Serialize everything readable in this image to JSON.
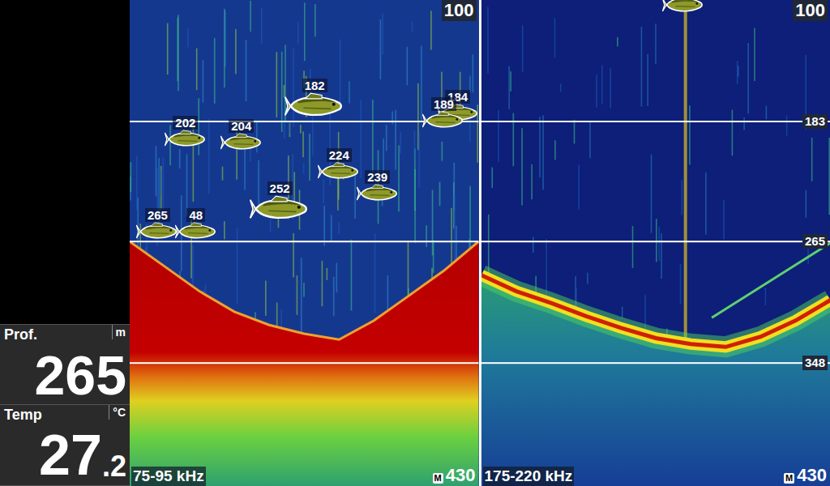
{
  "sidebar": {
    "depth_readout": {
      "label": "Prof.",
      "unit": "m",
      "value": "265"
    },
    "temp_readout": {
      "label": "Temp",
      "unit": "°C",
      "value_whole": "27",
      "value_fraction": ".2"
    }
  },
  "depth_scale": {
    "top_depth": 100,
    "bottom_depth": 432
  },
  "depth_lines": [
    {
      "depth": 183,
      "label": "183"
    },
    {
      "depth": 265,
      "label": "265"
    },
    {
      "depth": 348,
      "label": "348"
    }
  ],
  "panels": [
    {
      "frequency": "75-95 kHz",
      "range_top": "100",
      "range_bottom": "430",
      "mode": "M",
      "show_depth_labels": false,
      "bottom_profile": [
        265,
        282,
        299,
        313,
        322,
        328,
        332,
        319,
        302,
        285,
        265
      ],
      "echo_line": [],
      "fish": [
        {
          "label": "182",
          "depth": 182,
          "x": 0.53
        },
        {
          "label": "184",
          "depth": 184,
          "x": 0.94
        },
        {
          "label": "189",
          "depth": 189,
          "x": 0.9
        },
        {
          "label": "202",
          "depth": 202,
          "x": 0.16
        },
        {
          "label": "204",
          "depth": 204,
          "x": 0.32
        },
        {
          "label": "224",
          "depth": 224,
          "x": 0.6
        },
        {
          "label": "239",
          "depth": 239,
          "x": 0.71
        },
        {
          "label": "252",
          "depth": 252,
          "x": 0.43
        },
        {
          "label": "48",
          "depth": 265,
          "x": 0.19
        },
        {
          "label": "265",
          "depth": 265,
          "x": 0.08
        }
      ]
    },
    {
      "frequency": "175-220 kHz",
      "range_top": "100",
      "range_bottom": "430",
      "mode": "M",
      "show_depth_labels": true,
      "bottom_profile": [
        288,
        299,
        307,
        316,
        324,
        331,
        335,
        337,
        330,
        319,
        305
      ],
      "echo_line": [
        [
          0.66,
          317
        ],
        [
          1.0,
          266
        ]
      ],
      "fish": [
        {
          "label": "",
          "depth": 110,
          "x": 0.58
        }
      ]
    }
  ]
}
